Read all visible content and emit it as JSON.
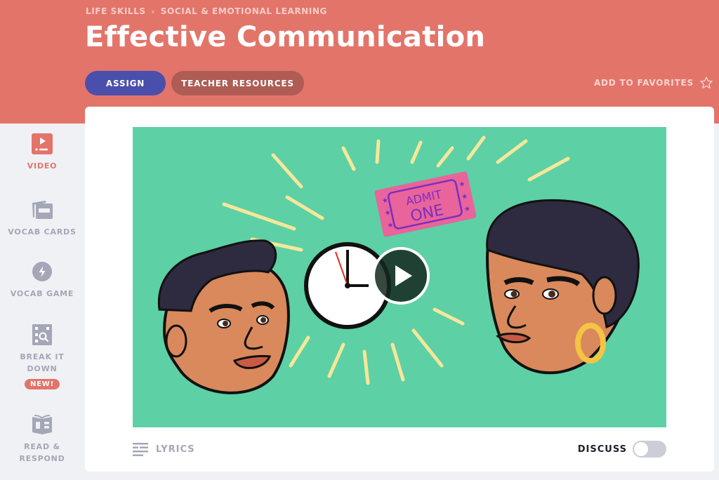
{
  "header": {
    "breadcrumb": [
      "LIFE SKILLS",
      "SOCIAL & EMOTIONAL LEARNING"
    ],
    "breadcrumb_separator": "›",
    "title": "Effective Communication",
    "assign_label": "ASSIGN",
    "resources_label": "TEACHER RESOURCES",
    "favorites_label": "ADD TO FAVORITES",
    "favorites_icon": "star-outline-icon"
  },
  "colors": {
    "brand": "#e3746a",
    "assign": "#4a4fac",
    "resources": "#ae5c54",
    "video_bg": "#5dd0a5",
    "inactive": "#a3a7b7"
  },
  "sidebar": {
    "items": [
      {
        "label": "VIDEO",
        "icon": "video-icon",
        "active": true
      },
      {
        "label": "VOCAB CARDS",
        "icon": "cards-icon",
        "active": false
      },
      {
        "label": "VOCAB GAME",
        "icon": "lightning-icon",
        "active": false
      },
      {
        "label": "BREAK IT DOWN",
        "icon": "magnify-grid-icon",
        "active": false,
        "badge": "NEW!"
      },
      {
        "label": "READ & RESPOND",
        "icon": "book-icon",
        "active": false
      }
    ]
  },
  "video": {
    "ticket_text_line1": "ADMIT",
    "ticket_text_line2": "ONE",
    "play_icon": "play-icon"
  },
  "footer": {
    "lyrics_label": "LYRICS",
    "discuss_label": "DISCUSS",
    "discuss_enabled": false
  }
}
